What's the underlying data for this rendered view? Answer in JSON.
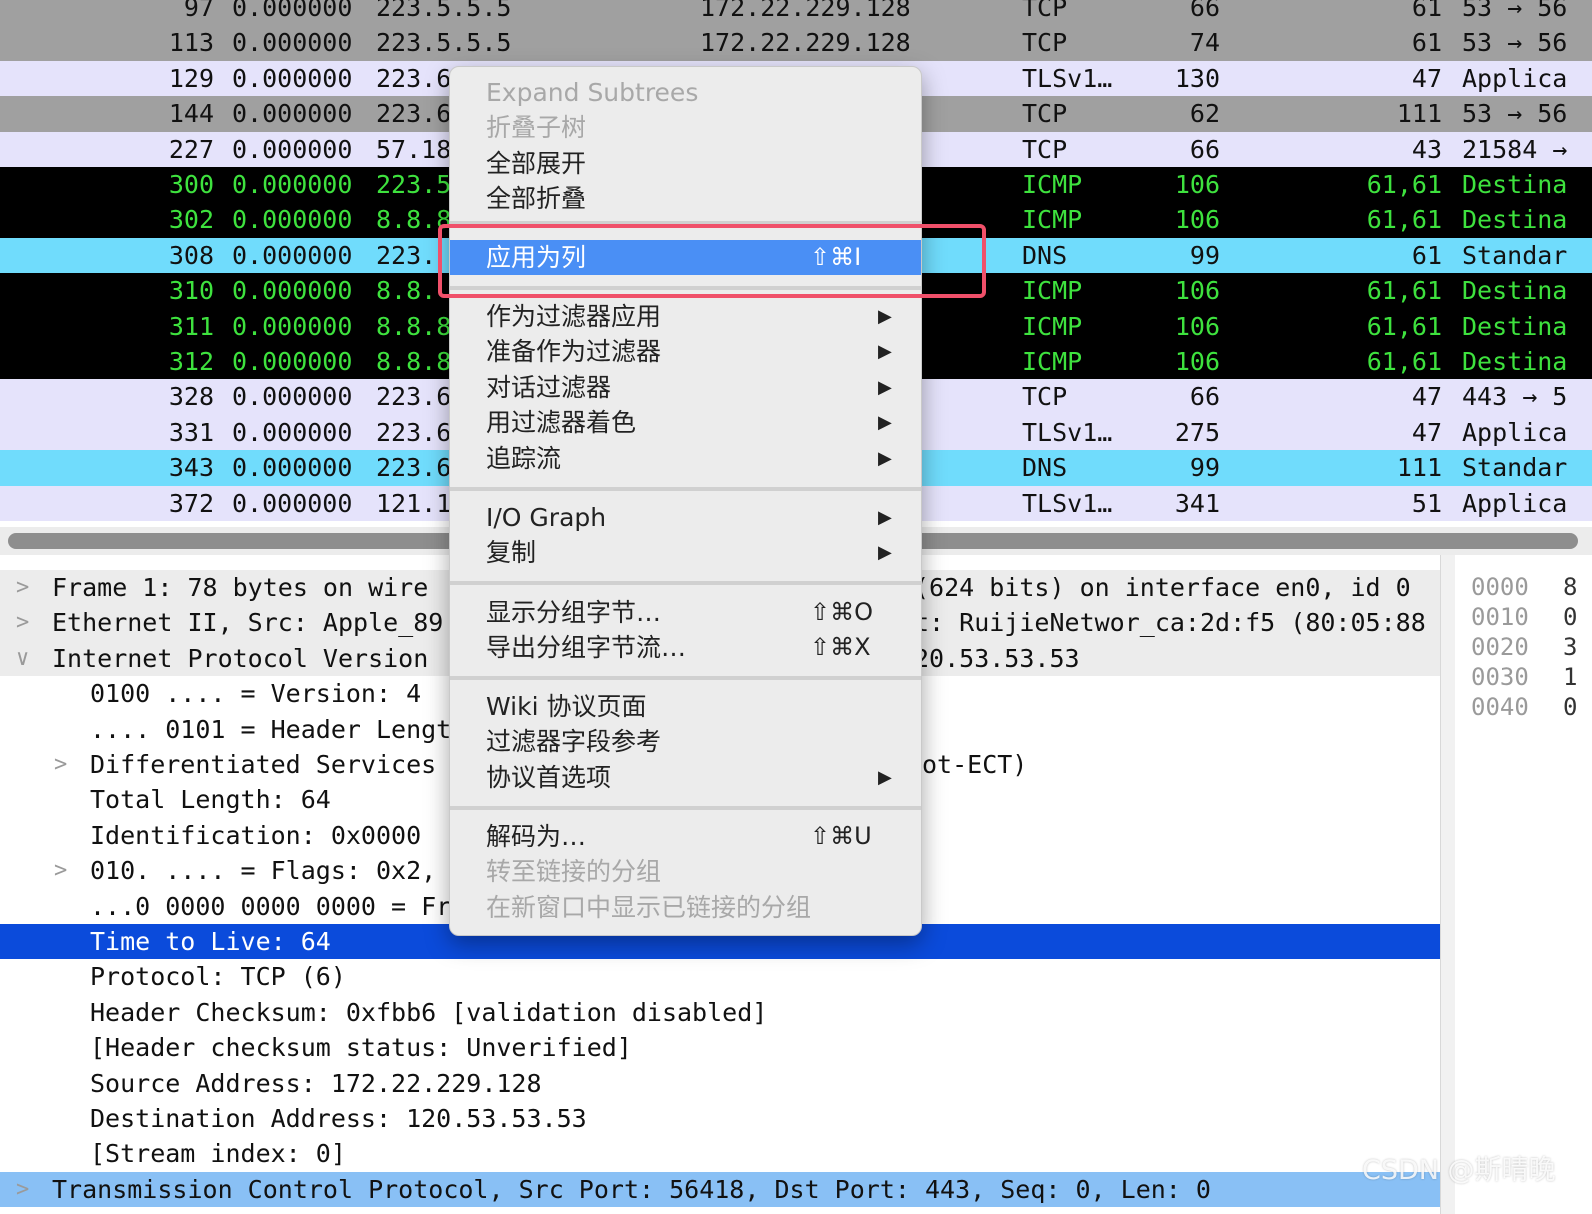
{
  "packet_list": {
    "rows": [
      {
        "no": "97",
        "time": "0.000000",
        "src": "223.5.5.5",
        "dst": "172.22.229.128",
        "proto": "TCP",
        "len": "66",
        "ttl": "61",
        "info": "53 → 56"
      },
      {
        "no": "113",
        "time": "0.000000",
        "src": "223.5.5.5",
        "dst": "172.22.229.128",
        "proto": "TCP",
        "len": "74",
        "ttl": "61",
        "info": "53 → 56"
      },
      {
        "no": "129",
        "time": "0.000000",
        "src": "223.6",
        "dst": "",
        "proto": "TLSv1…",
        "len": "130",
        "ttl": "47",
        "info": "Applica"
      },
      {
        "no": "144",
        "time": "0.000000",
        "src": "223.6",
        "dst": "",
        "proto": "TCP",
        "len": "62",
        "ttl": "111",
        "info": "53 → 56"
      },
      {
        "no": "227",
        "time": "0.000000",
        "src": "57.18",
        "dst": "",
        "proto": "TCP",
        "len": "66",
        "ttl": "43",
        "info": "21584 →"
      },
      {
        "no": "300",
        "time": "0.000000",
        "src": "223.5",
        "dst": "",
        "proto": "ICMP",
        "len": "106",
        "ttl": "61,61",
        "info": "Destina"
      },
      {
        "no": "302",
        "time": "0.000000",
        "src": "8.8.8",
        "dst": "",
        "proto": "ICMP",
        "len": "106",
        "ttl": "61,61",
        "info": "Destina"
      },
      {
        "no": "308",
        "time": "0.000000",
        "src": "223.",
        "dst": "",
        "proto": "DNS",
        "len": "99",
        "ttl": "61",
        "info": "Standar"
      },
      {
        "no": "310",
        "time": "0.000000",
        "src": "8.8.",
        "dst": "",
        "proto": "ICMP",
        "len": "106",
        "ttl": "61,61",
        "info": "Destina"
      },
      {
        "no": "311",
        "time": "0.000000",
        "src": "8.8.8",
        "dst": "",
        "proto": "ICMP",
        "len": "106",
        "ttl": "61,61",
        "info": "Destina"
      },
      {
        "no": "312",
        "time": "0.000000",
        "src": "8.8.8",
        "dst": "",
        "proto": "ICMP",
        "len": "106",
        "ttl": "61,61",
        "info": "Destina"
      },
      {
        "no": "328",
        "time": "0.000000",
        "src": "223.6",
        "dst": "",
        "proto": "TCP",
        "len": "66",
        "ttl": "47",
        "info": "443 → 5"
      },
      {
        "no": "331",
        "time": "0.000000",
        "src": "223.6",
        "dst": "",
        "proto": "TLSv1…",
        "len": "275",
        "ttl": "47",
        "info": "Applica"
      },
      {
        "no": "343",
        "time": "0.000000",
        "src": "223.6",
        "dst": "",
        "proto": "DNS",
        "len": "99",
        "ttl": "111",
        "info": "Standar"
      },
      {
        "no": "372",
        "time": "0.000000",
        "src": "121.1",
        "dst": "",
        "proto": "TLSv1…",
        "len": "341",
        "ttl": "51",
        "info": "Applica"
      }
    ]
  },
  "details": {
    "rows": [
      {
        "arrow": ">",
        "text": "Frame 1: 78 bytes on wire",
        "right": "(624 bits) on interface en0, id 0"
      },
      {
        "arrow": ">",
        "text": "Ethernet II, Src: Apple_89",
        "right": "t: RuijieNetwor_ca:2d:f5 (80:05:88"
      },
      {
        "arrow": "∨",
        "text": "Internet Protocol Version",
        "right": "20.53.53.53"
      },
      {
        "arrow": "",
        "text": "0100 .... = Version: 4",
        "right": ""
      },
      {
        "arrow": "",
        "text": ".... 0101 = Header Lengt",
        "right": ""
      },
      {
        "arrow": ">",
        "text": "Differentiated Services",
        "right": "ot-ECT)"
      },
      {
        "arrow": "",
        "text": "Total Length: 64",
        "right": ""
      },
      {
        "arrow": "",
        "text": "Identification: 0x0000",
        "right": ""
      },
      {
        "arrow": ">",
        "text": "010. .... = Flags: 0x2,",
        "right": ""
      },
      {
        "arrow": "",
        "text": "...0 0000 0000 0000 = Fr",
        "right": ""
      },
      {
        "arrow": "",
        "text": "Time to Live: 64",
        "right": ""
      },
      {
        "arrow": "",
        "text": "Protocol: TCP (6)",
        "right": ""
      },
      {
        "arrow": "",
        "text": "Header Checksum: 0xfbb6 [validation disabled]",
        "right": ""
      },
      {
        "arrow": "",
        "text": "[Header checksum status: Unverified]",
        "right": ""
      },
      {
        "arrow": "",
        "text": "Source Address: 172.22.229.128",
        "right": ""
      },
      {
        "arrow": "",
        "text": "Destination Address: 120.53.53.53",
        "right": ""
      },
      {
        "arrow": "",
        "text": "[Stream index: 0]",
        "right": ""
      },
      {
        "arrow": ">",
        "text": "Transmission Control Protocol, Src Port: 56418, Dst Port: 443, Seq: 0, Len: 0",
        "right": ""
      }
    ]
  },
  "bytes_pane": {
    "offsets": [
      "0000",
      "0010",
      "0020",
      "0030",
      "0040"
    ],
    "col2": [
      "8",
      "0",
      "3",
      "1",
      "0"
    ]
  },
  "context_menu": {
    "expand_subtrees": "Expand Subtrees",
    "collapse_subtrees": "折叠子树",
    "expand_all": "全部展开",
    "collapse_all": "全部折叠",
    "apply_as_column": "应用为列",
    "apply_as_column_shortcut": "⇧⌘I",
    "apply_as_filter": "作为过滤器应用",
    "prepare_as_filter": "准备作为过滤器",
    "conversation_filter": "对话过滤器",
    "colorize_with_filter": "用过滤器着色",
    "follow_stream": "追踪流",
    "io_graph": "I/O Graph",
    "copy": "复制",
    "show_packet_bytes": "显示分组字节…",
    "show_packet_bytes_shortcut": "⇧⌘O",
    "export_packet_bytes": "导出分组字节流…",
    "export_packet_bytes_shortcut": "⇧⌘X",
    "wiki_protocol_page": "Wiki 协议页面",
    "filter_field_reference": "过滤器字段参考",
    "protocol_preferences": "协议首选项",
    "decode_as": "解码为…",
    "decode_as_shortcut": "⇧⌘U",
    "go_to_linked_packet": "转至链接的分组",
    "show_linked_in_new_window": "在新窗口中显示已链接的分组",
    "submenu_arrow": "▶"
  },
  "watermark": "CSDN @斯晴晚",
  "colors": {
    "row_gray": "#a0a0a0",
    "row_lavender": "#e5e3fb",
    "row_black": "#000000",
    "icmp_text": "#3ee23e",
    "row_cyan": "#70dcfc",
    "selected_detail": "#0b4bdb",
    "menu_active": "#4a8ff5",
    "highlight_box": "#f0506a"
  }
}
